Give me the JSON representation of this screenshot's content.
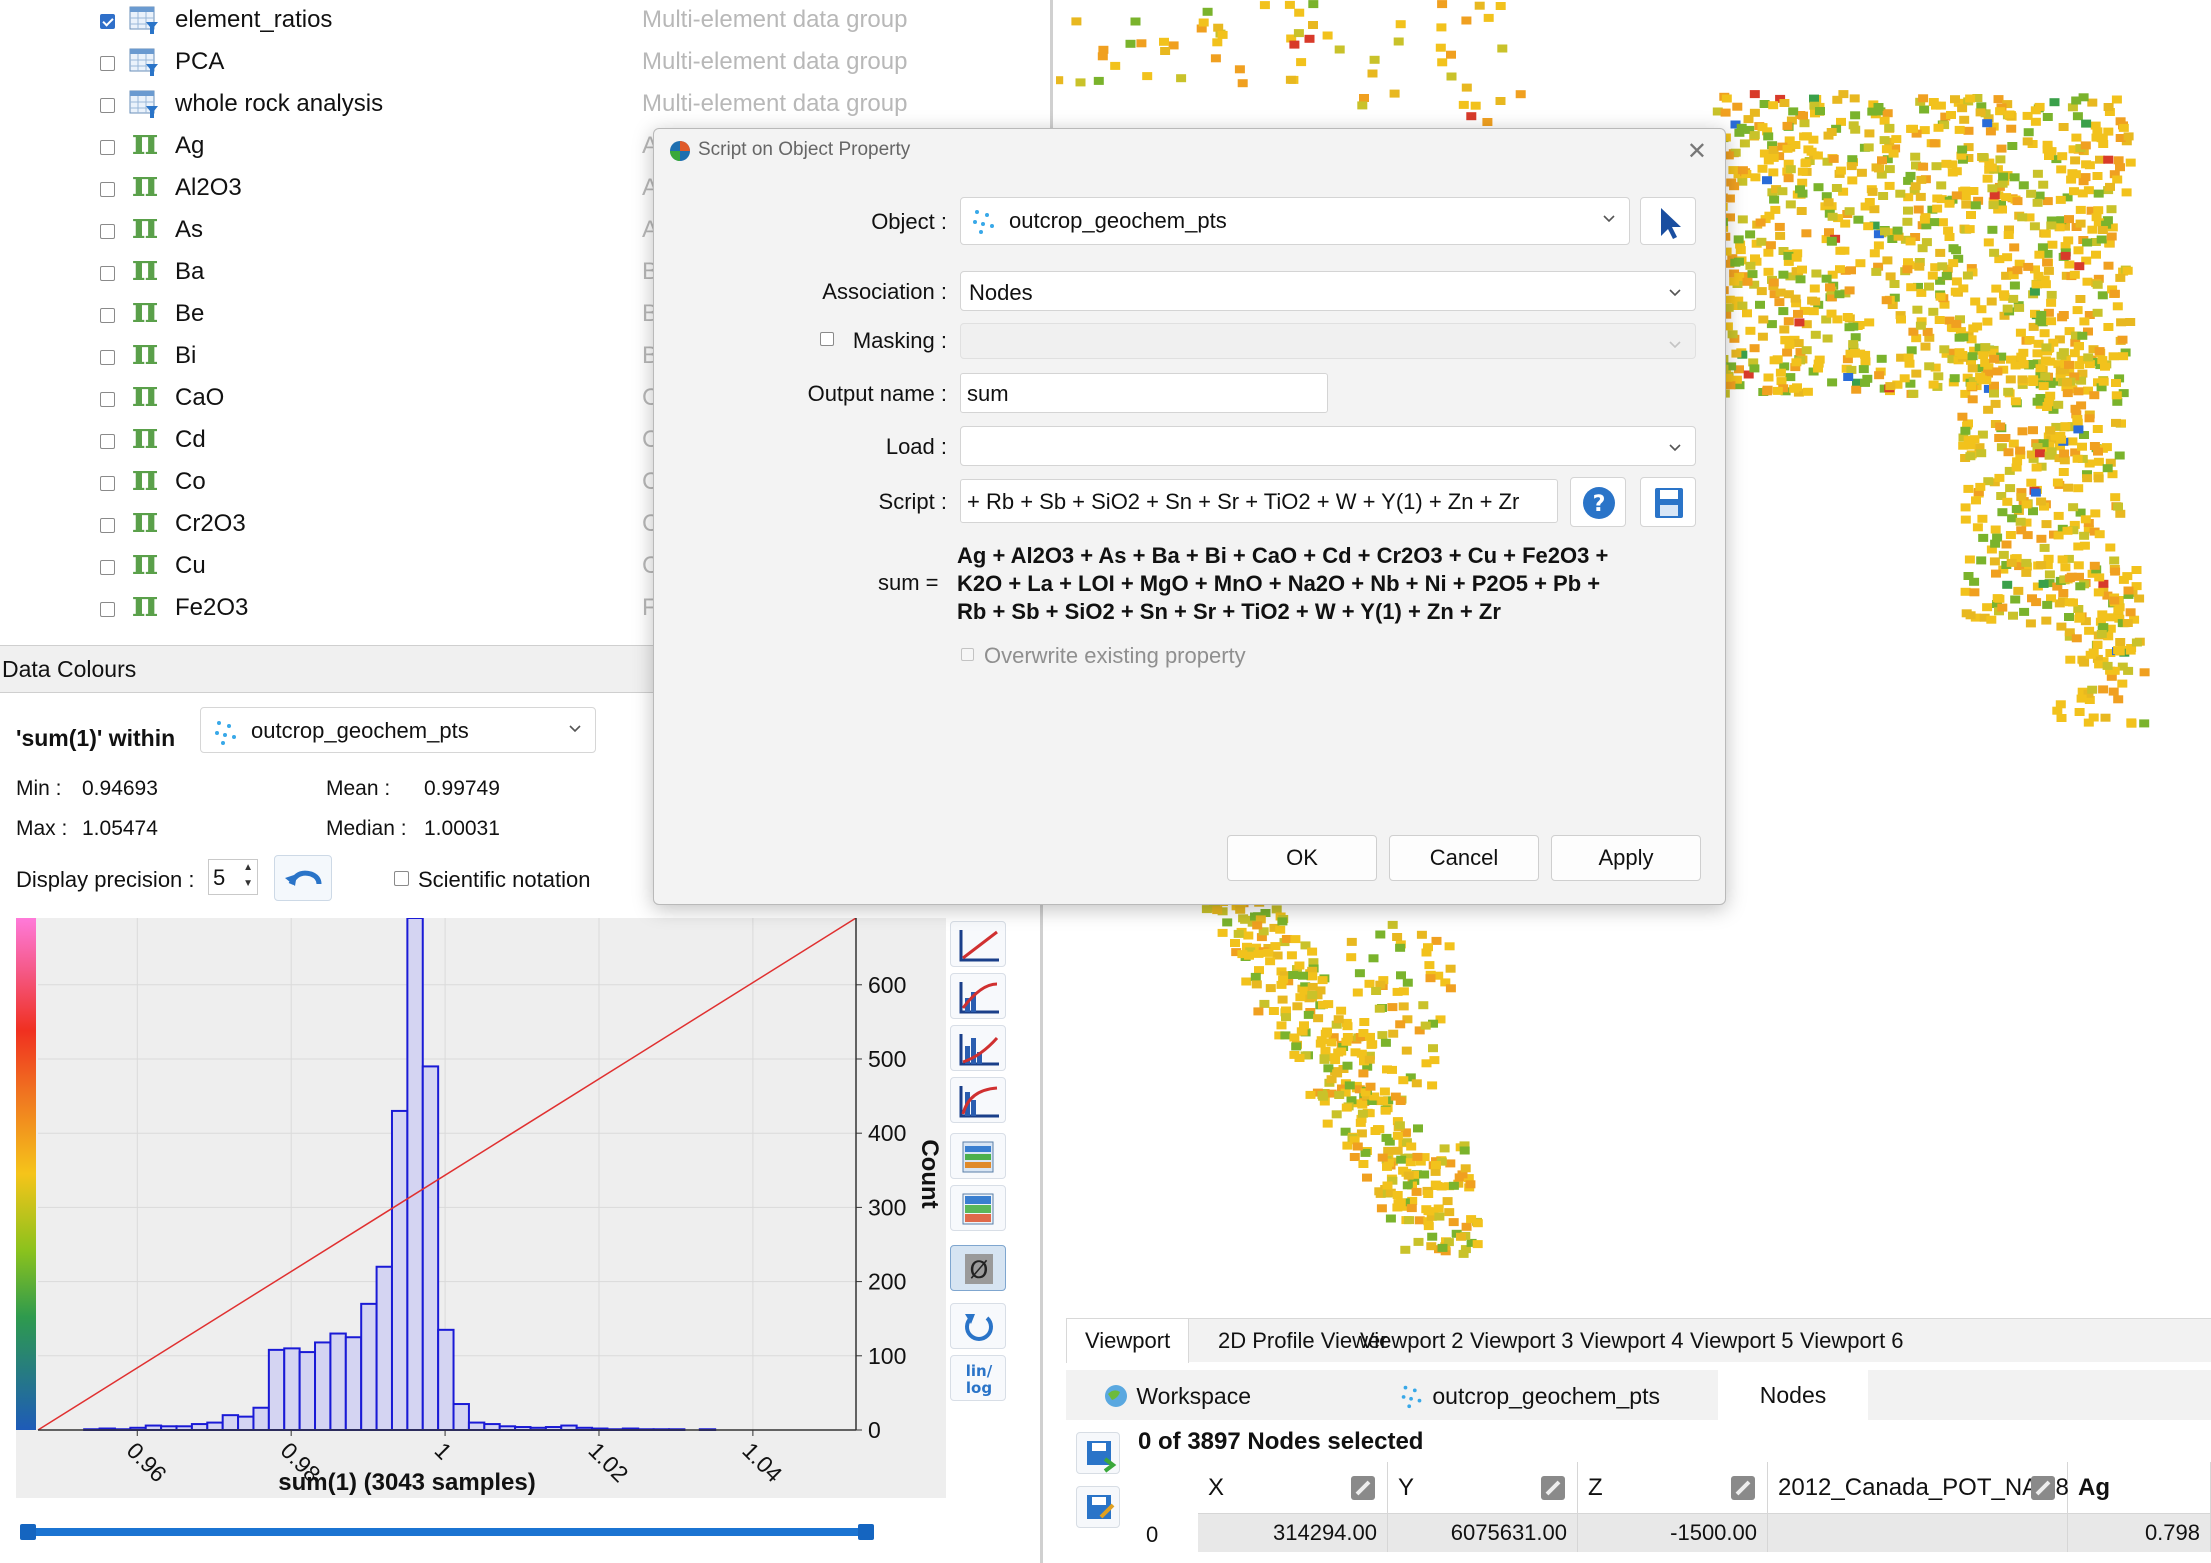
{
  "tree": {
    "items": [
      {
        "label": "element_ratios",
        "type": "Multi-element data group",
        "checked": true,
        "icon": "table-filter-icon"
      },
      {
        "label": "PCA",
        "type": "Multi-element data group",
        "checked": false,
        "icon": "table-filter-icon"
      },
      {
        "label": "whole rock analysis",
        "type": "Multi-element data group",
        "checked": false,
        "icon": "table-filter-icon"
      },
      {
        "label": "Ag",
        "type": "A",
        "checked": false,
        "icon": "pi-icon"
      },
      {
        "label": "Al2O3",
        "type": "A",
        "checked": false,
        "icon": "pi-icon"
      },
      {
        "label": "As",
        "type": "A",
        "checked": false,
        "icon": "pi-icon"
      },
      {
        "label": "Ba",
        "type": "B",
        "checked": false,
        "icon": "pi-icon"
      },
      {
        "label": "Be",
        "type": "B",
        "checked": false,
        "icon": "pi-icon"
      },
      {
        "label": "Bi",
        "type": "B",
        "checked": false,
        "icon": "pi-icon"
      },
      {
        "label": "CaO",
        "type": "C",
        "checked": false,
        "icon": "pi-icon"
      },
      {
        "label": "Cd",
        "type": "C",
        "checked": false,
        "icon": "pi-icon"
      },
      {
        "label": "Co",
        "type": "C",
        "checked": false,
        "icon": "pi-icon"
      },
      {
        "label": "Cr2O3",
        "type": "C",
        "checked": false,
        "icon": "pi-icon"
      },
      {
        "label": "Cu",
        "type": "C",
        "checked": false,
        "icon": "pi-icon"
      },
      {
        "label": "Fe2O3",
        "type": "F",
        "checked": false,
        "icon": "pi-icon"
      }
    ]
  },
  "data_colours": {
    "header": "Data Colours",
    "within_label": "'sum(1)' within",
    "object": "outcrop_geochem_pts",
    "min_label": "Min :",
    "min": "0.94693",
    "max_label": "Max :",
    "max": "1.05474",
    "mean_label": "Mean :",
    "mean": "0.99749",
    "median_label": "Median :",
    "median": "1.00031",
    "precision_label": "Display precision :",
    "precision": "5",
    "sci_label": "Scientific notation"
  },
  "chart_data": {
    "type": "bar",
    "xlabel": "sum(1) (3043 samples)",
    "ylabel": "Count",
    "xlim": [
      0.9471,
      1.0534
    ],
    "ylim": [
      0,
      690
    ],
    "x_ticks": [
      "0.96",
      "0.98",
      "1",
      "1.02",
      "1.04"
    ],
    "y_ticks": [
      "0",
      "100",
      "200",
      "300",
      "400",
      "500",
      "600"
    ],
    "bin_width": 0.002,
    "bin_start": 0.9471,
    "values": [
      0,
      0,
      0,
      1,
      2,
      1,
      3,
      6,
      5,
      5,
      8,
      10,
      20,
      18,
      30,
      108,
      110,
      105,
      118,
      130,
      125,
      170,
      220,
      430,
      690,
      490,
      135,
      35,
      10,
      8,
      5,
      4,
      3,
      4,
      6,
      3,
      2,
      1,
      2,
      1,
      1,
      1,
      0,
      1,
      0,
      0,
      0,
      0,
      0,
      0,
      0,
      0,
      0
    ],
    "cdf_line": {
      "x": [
        0.9471,
        1.0534
      ],
      "y": [
        0,
        690
      ],
      "color": "#e03030"
    },
    "bar_color": "#1a1ad6"
  },
  "dialog": {
    "title": "Script on Object Property",
    "object_label": "Object :",
    "object_value": "outcrop_geochem_pts",
    "association_label": "Association :",
    "association_value": "Nodes",
    "masking_label": "Masking :",
    "output_label": "Output name :",
    "output_value": "sum",
    "load_label": "Load :",
    "script_label": "Script :",
    "script_value": "+ Rb + Sb + SiO2 + Sn + Sr + TiO2 + W + Y(1) + Zn + Zr",
    "sum_label": "sum  =",
    "expr_lines": [
      "Ag + Al2O3 + As + Ba + Bi + CaO + Cd + Cr2O3 + Cu + Fe2O3 +",
      "K2O + La + LOI + MgO + MnO + Na2O + Nb + Ni + P2O5 + Pb +",
      "Rb + Sb + SiO2 + Sn + Sr + TiO2 + W + Y(1) + Zn + Zr"
    ],
    "overwrite_label": "Overwrite existing property",
    "ok": "OK",
    "cancel": "Cancel",
    "apply": "Apply"
  },
  "viewport_tabs": [
    "Viewport",
    "2D Profile Viewer",
    "Viewport 2",
    "Viewport 3",
    "Viewport 4",
    "Viewport 5",
    "Viewport 6"
  ],
  "sub_tabs": {
    "workspace": "Workspace",
    "object": "outcrop_geochem_pts",
    "nodes": "Nodes"
  },
  "nodes": {
    "count_text": "0 of 3897 Nodes selected",
    "columns": [
      "X",
      "Y",
      "Z",
      "2012_Canada_POT_NAD83",
      "Ag"
    ],
    "row_index": "0",
    "row": [
      "314294.00",
      "6075631.00",
      "-1500.00",
      "",
      "0.798"
    ]
  },
  "colors": {
    "accent": "#1b74d2",
    "point_yellow": "#f2c21c",
    "point_green": "#7ab32c",
    "point_orange": "#f0a020"
  }
}
